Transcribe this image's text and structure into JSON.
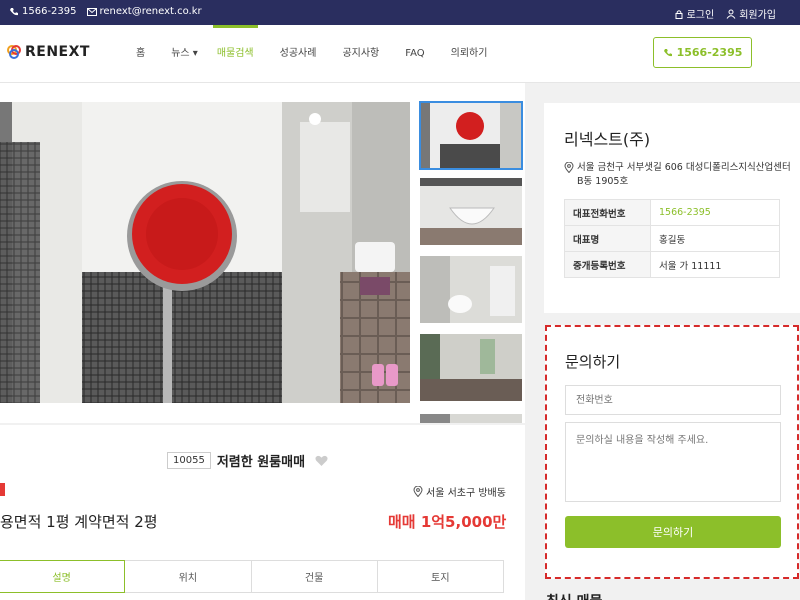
{
  "topbar": {
    "phone": "1566-2395",
    "email": "renext@renext.co.kr",
    "login": "로그인",
    "signup": "회원가입"
  },
  "header": {
    "logo_text": "RENEXT",
    "nav": [
      {
        "label": "홈"
      },
      {
        "label": "뉴스 ▾"
      },
      {
        "label": "매물검색",
        "active": true
      },
      {
        "label": "성공사례"
      },
      {
        "label": "공지사항"
      },
      {
        "label": "FAQ"
      },
      {
        "label": "의뢰하기"
      }
    ],
    "phone_button": "1566-2395"
  },
  "gallery": {
    "thumbnail_count": 5,
    "selected_index": 0
  },
  "listing": {
    "code": "10055",
    "title": "저렴한 원룸매매",
    "location": "서울 서초구 방배동",
    "area_text": "용면적 1평 계약면적 2평",
    "price_text": "매매 1억5,000만",
    "tabs": [
      "설명",
      "위치",
      "건물",
      "토지"
    ],
    "active_tab": 0
  },
  "agency": {
    "name": "리넥스트(주)",
    "address": "서울 금천구 서부샛길 606 대성디폴리스지식산업센터 B동 1905호",
    "rows": [
      {
        "label": "대표전화번호",
        "value": "1566-2395"
      },
      {
        "label": "대표명",
        "value": "홍길동"
      },
      {
        "label": "중개등록번호",
        "value": "서울 가 11111"
      }
    ]
  },
  "inquiry": {
    "title": "문의하기",
    "phone_placeholder": "전화번호",
    "message_placeholder": "문의하실 내용을 작성해 주세요.",
    "submit_label": "문의하기"
  },
  "recent_heading": "최신 매물",
  "colors": {
    "brand_green": "#8cbf2a",
    "topbar_navy": "#2a2e5f",
    "price_red": "#e53935"
  }
}
